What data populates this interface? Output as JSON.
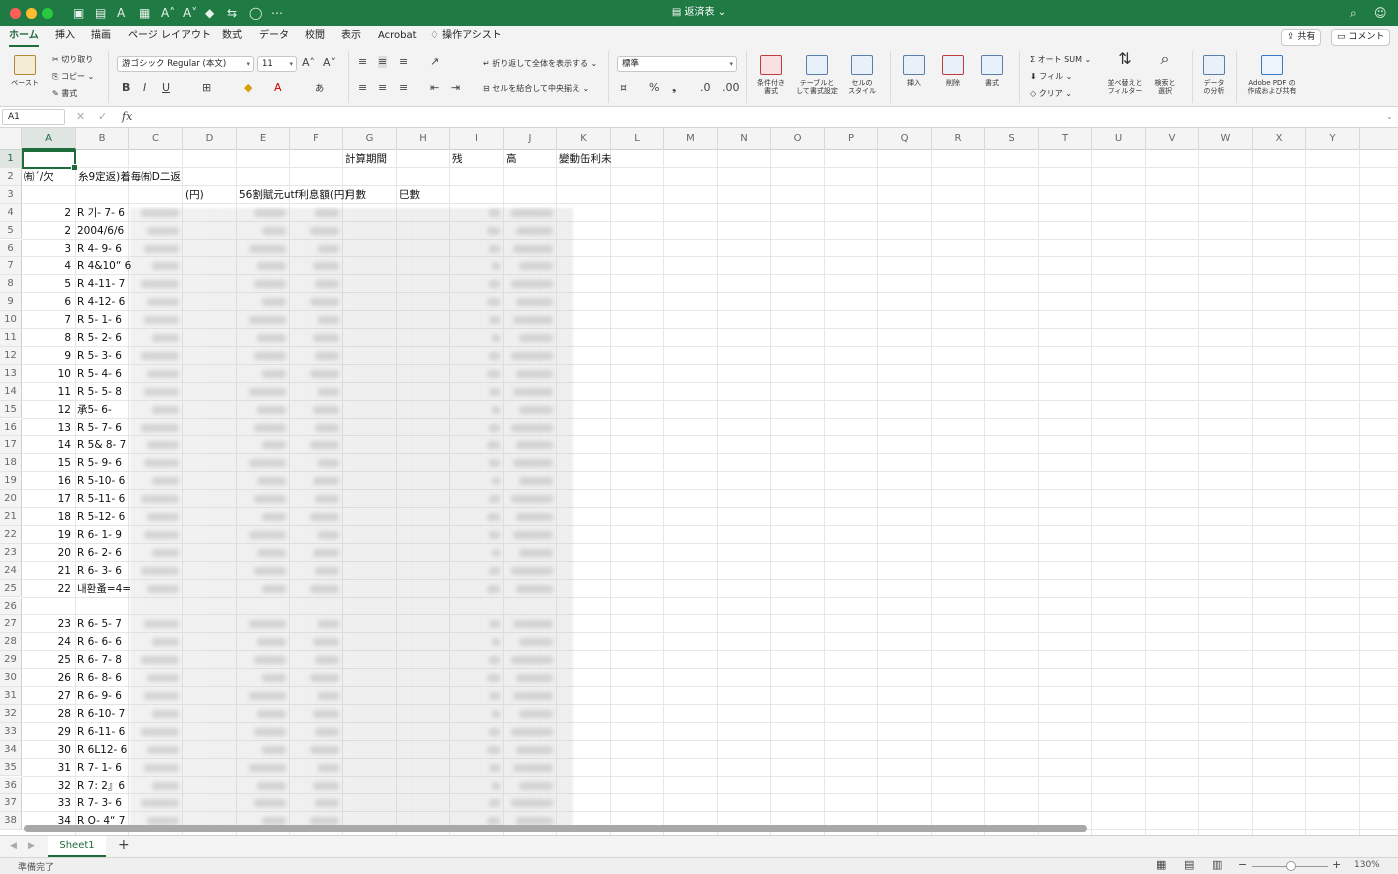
{
  "window": {
    "title": "返済表",
    "qa_icons": [
      "save-icon",
      "table-icon",
      "font-color-icon",
      "grid-icon",
      "font-increase-icon",
      "font-decrease-icon",
      "fill-icon",
      "sort-icon",
      "circle-icon",
      "more-icon"
    ]
  },
  "menubar": {
    "tabs": [
      "ホーム",
      "挿入",
      "描画",
      "ページ レイアウト",
      "数式",
      "データ",
      "校閲",
      "表示",
      "Acrobat"
    ],
    "assist": "操作アシスト",
    "share": "共有",
    "comment": "コメント"
  },
  "ribbon": {
    "paste": "ペースト",
    "cut": "切り取り",
    "copy": "コピー",
    "format_painter": "書式",
    "font_name": "游ゴシック Regular (本文)",
    "font_size": "11",
    "wrap_text": "折り返して全体を表示する",
    "merge_center": "セルを結合して中央揃え",
    "number_format": "標準",
    "cond_format": "条件付き\n書式",
    "table_format": "テーブルと\nして書式設定",
    "cell_style": "セルの\nスタイル",
    "insert": "挿入",
    "delete": "削除",
    "format": "書式",
    "autosum": "オート SUM",
    "fill": "フィル",
    "clear": "クリア",
    "sort_filter": "並べ替えと\nフィルター",
    "find_select": "検索と\n選択",
    "analyze": "データ\nの分析",
    "adobe_pdf": "Adobe PDF の\n作成および共有"
  },
  "formula_bar": {
    "name_box": "A1",
    "fx": "fx",
    "value": ""
  },
  "columns": [
    "A",
    "B",
    "C",
    "D",
    "E",
    "F",
    "G",
    "H",
    "I",
    "J",
    "K",
    "L",
    "M",
    "N",
    "O",
    "P",
    "Q",
    "R",
    "S",
    "T",
    "U",
    "V",
    "W",
    "X",
    "Y"
  ],
  "rows": [
    1,
    2,
    3,
    4,
    5,
    6,
    7,
    8,
    9,
    10,
    11,
    12,
    13,
    14,
    15,
    16,
    17,
    18,
    19,
    20,
    21,
    22,
    23,
    24,
    25,
    26,
    27,
    28,
    29,
    30,
    31,
    32,
    33,
    34,
    35,
    36,
    37,
    38
  ],
  "headers": {
    "r1": {
      "G": "計算期間",
      "I": "残",
      "J": "高",
      "K": "變動缶利未"
    },
    "r2": {
      "A": "㈲ˊ/欠",
      "B": "糸9定返)着毎㈲D二返"
    },
    "r3": {
      "D": "(円)",
      "E": "56割賦元utf利息額(円)",
      "G": "月數",
      "H": "巳數"
    }
  },
  "data_rows": [
    {
      "row": 4,
      "a": "2",
      "b": "R 기- 7- 6"
    },
    {
      "row": 5,
      "a": "2",
      "b": "2004/6/6"
    },
    {
      "row": 6,
      "a": "3",
      "b": "R 4- 9- 6"
    },
    {
      "row": 7,
      "a": "4",
      "b": "R 4&10“ 6"
    },
    {
      "row": 8,
      "a": "5",
      "b": "R 4-11- 7"
    },
    {
      "row": 9,
      "a": "6",
      "b": "R 4-12- 6"
    },
    {
      "row": 10,
      "a": "7",
      "b": "R 5- 1- 6"
    },
    {
      "row": 11,
      "a": "8",
      "b": "R 5- 2- 6"
    },
    {
      "row": 12,
      "a": "9",
      "b": "R 5- 3- 6"
    },
    {
      "row": 13,
      "a": "10",
      "b": "R 5- 4- 6"
    },
    {
      "row": 14,
      "a": "11",
      "b": "R 5- 5- 8"
    },
    {
      "row": 15,
      "a": "12",
      "b": "承5- 6-"
    },
    {
      "row": 16,
      "a": "13",
      "b": "R 5- 7- 6"
    },
    {
      "row": 17,
      "a": "14",
      "b": "R 5& 8- 7"
    },
    {
      "row": 18,
      "a": "15",
      "b": "R 5- 9- 6"
    },
    {
      "row": 19,
      "a": "16",
      "b": "R 5-10- 6"
    },
    {
      "row": 20,
      "a": "17",
      "b": "R 5-11- 6"
    },
    {
      "row": 21,
      "a": "18",
      "b": "R 5-12- 6"
    },
    {
      "row": 22,
      "a": "19",
      "b": "R 6- 1- 9"
    },
    {
      "row": 23,
      "a": "20",
      "b": "R 6- 2- 6"
    },
    {
      "row": 24,
      "a": "21",
      "b": "R 6- 3- 6"
    },
    {
      "row": 25,
      "a": "22",
      "b": "내환蚤=4="
    },
    {
      "row": 27,
      "a": "23",
      "b": "R 6- 5- 7"
    },
    {
      "row": 28,
      "a": "24",
      "b": "R 6- 6- 6"
    },
    {
      "row": 29,
      "a": "25",
      "b": "R 6- 7- 8"
    },
    {
      "row": 30,
      "a": "26",
      "b": "R 6- 8- 6"
    },
    {
      "row": 31,
      "a": "27",
      "b": "R 6- 9- 6"
    },
    {
      "row": 32,
      "a": "28",
      "b": "R 6-10- 7"
    },
    {
      "row": 33,
      "a": "29",
      "b": "R 6-11- 6"
    },
    {
      "row": 34,
      "a": "30",
      "b": "R 6L12- 6"
    },
    {
      "row": 35,
      "a": "31",
      "b": "R 7- 1- 6"
    },
    {
      "row": 36,
      "a": "32",
      "b": "R 7: 2』6"
    },
    {
      "row": 37,
      "a": "33",
      "b": "R 7- 3- 6"
    },
    {
      "row": 38,
      "a": "34",
      "b": "R O- 4“ 7"
    }
  ],
  "sheets": [
    "Sheet1"
  ],
  "status": {
    "ready": "準備完了",
    "zoom": "130%"
  },
  "colors": {
    "accent": "#1e6b3b",
    "titlebar": "#1f7a43"
  }
}
